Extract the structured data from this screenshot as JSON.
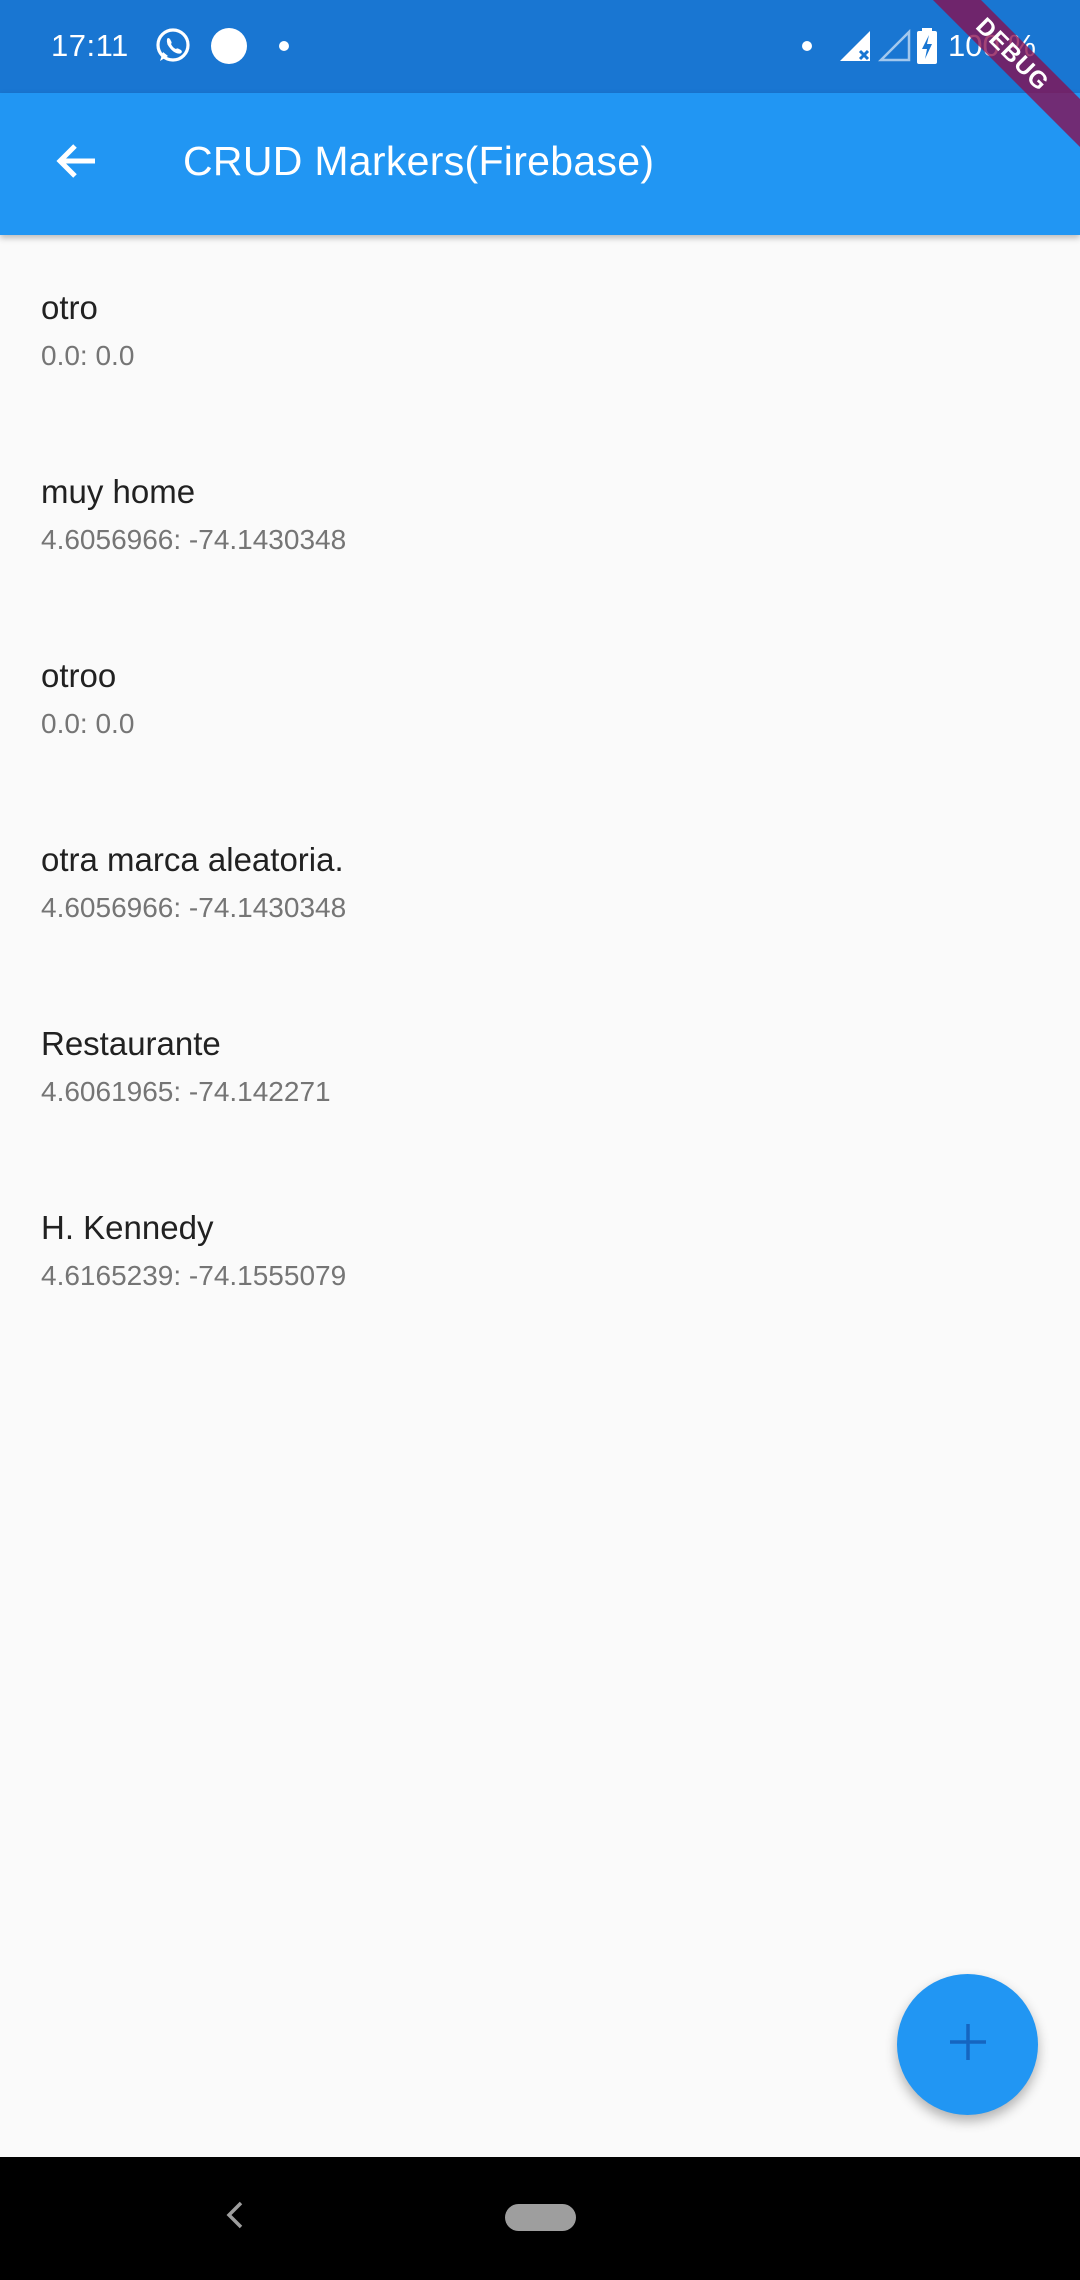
{
  "status_bar": {
    "time": "17:11",
    "battery": "100 %",
    "icons": [
      "whatsapp-icon",
      "circle-notification-icon",
      "dot-icon",
      "dot-icon",
      "signal-icon",
      "signal-empty-icon",
      "battery-charging-icon"
    ]
  },
  "debug_banner": "DEBUG",
  "app_bar": {
    "title": "CRUD Markers(Firebase)",
    "back_icon": "arrow-back-icon"
  },
  "markers": [
    {
      "title": "otro",
      "coords": "0.0: 0.0"
    },
    {
      "title": "muy home",
      "coords": "4.6056966: -74.1430348"
    },
    {
      "title": "otroo",
      "coords": "0.0: 0.0"
    },
    {
      "title": "otra marca aleatoria.",
      "coords": "4.6056966: -74.1430348"
    },
    {
      "title": "Restaurante",
      "coords": "4.6061965: -74.142271"
    },
    {
      "title": "H. Kennedy",
      "coords": "4.6165239: -74.1555079"
    }
  ],
  "fab": {
    "icon": "add-icon"
  },
  "nav_bar": {
    "icons": [
      "nav-back-icon",
      "nav-home-pill"
    ]
  },
  "colors": {
    "primary": "#2196f3",
    "status_bar": "#1976d2",
    "background": "#fafafa",
    "fab_icon": "#1565c0"
  }
}
